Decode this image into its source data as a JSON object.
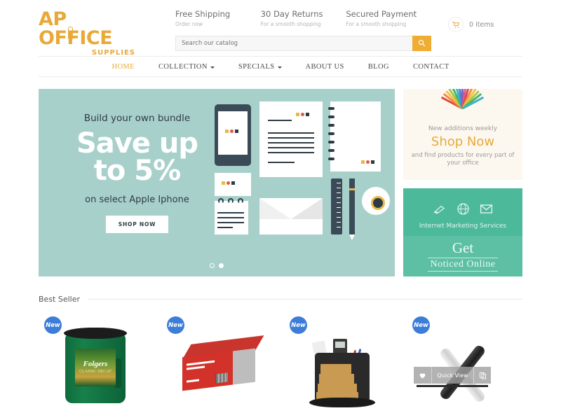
{
  "header": {
    "logo_main": "AP",
    "logo_main2": "OFFICE",
    "logo_sub": "SUPPLIES",
    "promos": [
      {
        "title": "Free Shipping",
        "sub": "Order now"
      },
      {
        "title": "30 Day Returns",
        "sub": "For a smooth shopping"
      },
      {
        "title": "Secured Payment",
        "sub": "For a smooth shopping"
      }
    ],
    "search": {
      "placeholder": "Search our catalog",
      "value": "",
      "icon": "search-icon"
    },
    "cart": {
      "icon": "shopping-cart-icon",
      "label": "0 items"
    }
  },
  "nav": {
    "items": [
      {
        "label": "HOME",
        "active": true,
        "caret": false
      },
      {
        "label": "COLLECTION",
        "active": false,
        "caret": true
      },
      {
        "label": "SPECIALS",
        "active": false,
        "caret": true
      },
      {
        "label": "ABOUT US",
        "active": false,
        "caret": false
      },
      {
        "label": "BLOG",
        "active": false,
        "caret": false
      },
      {
        "label": "CONTACT",
        "active": false,
        "caret": false
      }
    ]
  },
  "hero": {
    "kicker": "Build your own bundle",
    "headline_line1": "Save up",
    "headline_line2": "to 5%",
    "subline": "on select Apple Iphone",
    "button": "SHOP NOW",
    "background_color": "#a8d0cb",
    "slides": 2,
    "active_slide": 2
  },
  "promo_card": {
    "title": "New additions weekly",
    "big": "Shop Now",
    "sub": "and find products for every part of your office",
    "accent_color": "#e8a93a",
    "background_color": "#fdf8ef"
  },
  "teal_card": {
    "icons": [
      "pen-nib-icon",
      "globe-icon",
      "envelope-icon"
    ],
    "label": "Internet Marketing Services",
    "big1": "Get",
    "big2": "Noticed Online",
    "background_color": "#4bb99a"
  },
  "best_seller": {
    "title": "Best Seller",
    "products": [
      {
        "badge": "New",
        "name": "folgers-classic-decaf-coffee",
        "brand": "Folgers",
        "variant": "CLASSIC DECAF",
        "hover": false
      },
      {
        "badge": "New",
        "name": "copy-paper-case",
        "brand": "",
        "variant": "",
        "hover": false
      },
      {
        "badge": "New",
        "name": "rotating-desk-organizer",
        "brand": "",
        "variant": "",
        "hover": false
      },
      {
        "badge": "New",
        "name": "ballpoint-pens",
        "brand": "",
        "variant": "",
        "hover": true
      }
    ],
    "hover_actions": {
      "wishlist_icon": "heart-icon",
      "quick_view": "Quick View",
      "compare_icon": "compare-icon"
    }
  },
  "colors": {
    "brand_orange": "#e8a93a",
    "search_button": "#f0ad34",
    "badge_blue": "#3b7dd8",
    "hero_teal": "#a8d0cb",
    "marketing_teal": "#4bb99a"
  }
}
